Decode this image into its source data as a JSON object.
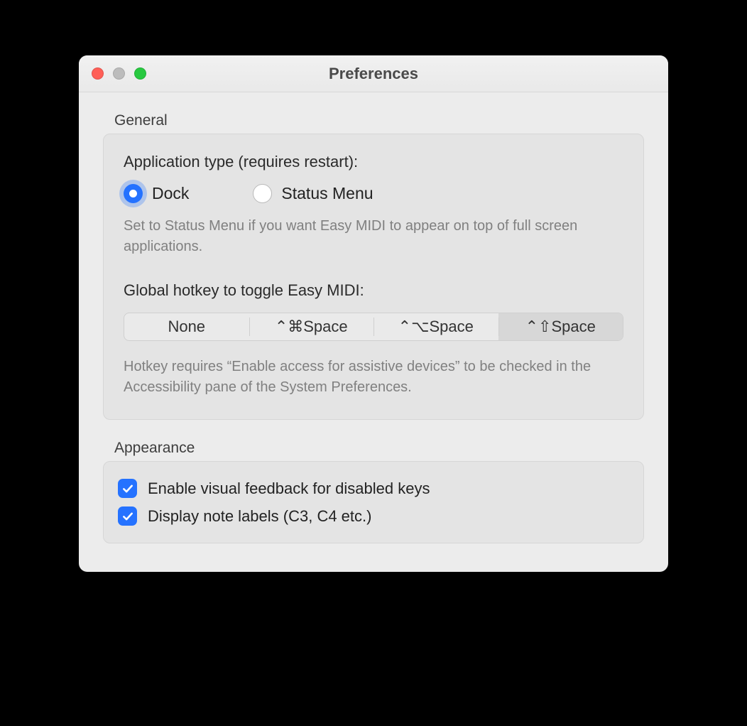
{
  "window": {
    "title": "Preferences"
  },
  "sections": {
    "general": {
      "label": "General",
      "app_type": {
        "label": "Application type (requires restart):",
        "options": {
          "dock": "Dock",
          "status_menu": "Status Menu"
        },
        "selected": "dock",
        "help": "Set to Status Menu if you want Easy MIDI to appear on top of full screen applications."
      },
      "hotkey": {
        "label": "Global hotkey to toggle Easy MIDI:",
        "segments": [
          "None",
          "⌃⌘Space",
          "⌃⌥Space",
          "⌃⇧Space"
        ],
        "selected_index": 3,
        "help": "Hotkey requires “Enable access for assistive devices” to be checked in the Accessibility pane of the System Preferences."
      }
    },
    "appearance": {
      "label": "Appearance",
      "checks": {
        "visual_feedback": {
          "label": "Enable visual feedback for disabled keys",
          "checked": true
        },
        "note_labels": {
          "label": "Display note labels (C3, C4 etc.)",
          "checked": true
        }
      }
    }
  }
}
